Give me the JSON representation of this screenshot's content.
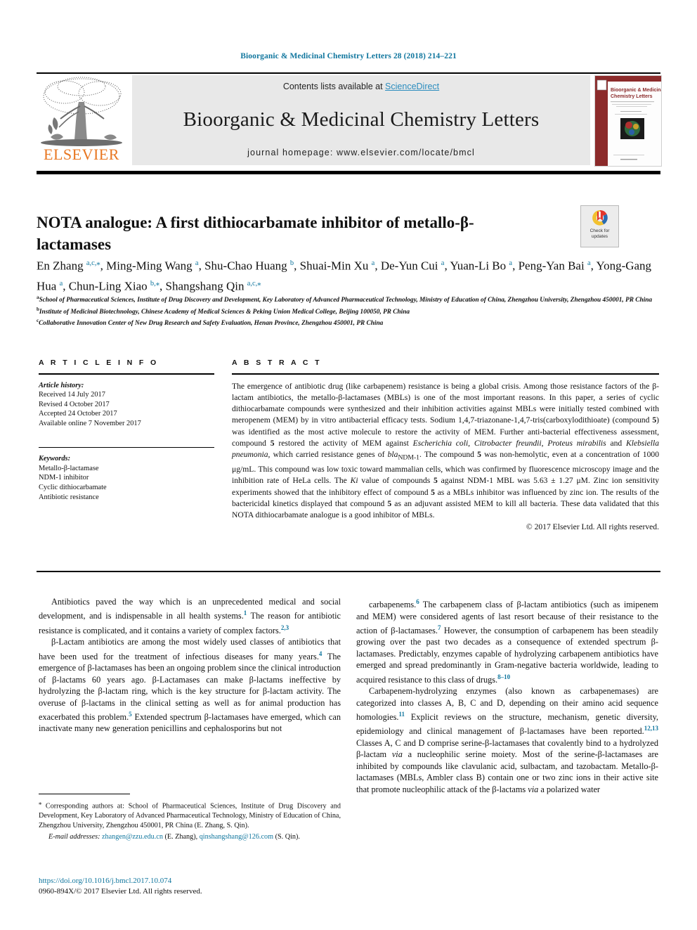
{
  "running_head": "Bioorganic & Medicinal Chemistry Letters 28 (2018) 214–221",
  "masthead": {
    "contents_prefix": "Contents lists available at ",
    "sciencedirect": "ScienceDirect",
    "journal_title": "Bioorganic & Medicinal Chemistry Letters",
    "homepage": "journal homepage: www.elsevier.com/locate/bmcl",
    "publisher_name": "ELSEVIER",
    "cover_title_line1": "Bioorganic & Medicinal",
    "cover_title_line2": "Chemistry Letters"
  },
  "article": {
    "title": "NOTA analogue: A first dithiocarbamate inhibitor of metallo-β-lactamases",
    "crossmark_line1": "Check for",
    "crossmark_line2": "updates",
    "authors_html": "En Zhang <sup>a,c,</sup><sup>⁎</sup>, Ming-Ming Wang <sup>a</sup>, Shu-Chao Huang <sup>b</sup>, Shuai-Min Xu <sup>a</sup>, De-Yun Cui <sup>a</sup>, Yuan-Li Bo <sup>a</sup>, Peng-Yan Bai <sup>a</sup>, Yong-Gang Hua <sup>a</sup>, Chun-Ling Xiao <sup>b,</sup><sup>⁎</sup>, Shangshang Qin <sup>a,c,</sup><sup>⁎</sup>",
    "affiliations": [
      {
        "marker": "a",
        "text": "School of Pharmaceutical Sciences, Institute of Drug Discovery and Development, Key Laboratory of Advanced Pharmaceutical Technology, Ministry of Education of China, Zhengzhou University, Zhengzhou 450001, PR China"
      },
      {
        "marker": "b",
        "text": "Institute of Medicinal Biotechnology, Chinese Academy of Medical Sciences & Peking Union Medical College, Beijing 100050, PR China"
      },
      {
        "marker": "c",
        "text": "Collaborative Innovation Center of New Drug Research and Safety Evaluation, Henan Province, Zhengzhou 450001, PR China"
      }
    ]
  },
  "article_info": {
    "heading": "A R T I C L E   I N F O",
    "history_label": "Article history:",
    "history": [
      "Received 14 July 2017",
      "Revised 4 October 2017",
      "Accepted 24 October 2017",
      "Available online 7 November 2017"
    ],
    "keywords_label": "Keywords:",
    "keywords": [
      "Metallo-β-lactamase",
      "NDM-1 inhibitor",
      "Cyclic dithiocarbamate",
      "Antibiotic resistance"
    ]
  },
  "abstract": {
    "heading": "A B S T R A C T",
    "body_html": "The emergence of antibiotic drug (like carbapenem) resistance is being a global crisis. Among those resistance factors of the β-lactam antibiotics, the metallo-β-lactamases (MBLs) is one of the most important reasons. In this paper, a series of cyclic dithiocarbamate compounds were synthesized and their inhibition activities against MBLs were initially tested combined with meropenem (MEM) by in vitro antibacterial efficacy tests. Sodium 1,4,7-triazonane-1,4,7-tris(carboxylodithioate) (compound <b>5</b>) was identified as the most active molecule to restore the activity of MEM. Further anti-bacterial effectiveness assessment, compound <b>5</b> restored the activity of MEM against <i>Escherichia coli</i>, <i>Citrobacter freundii</i>, <i>Proteus mirabilis</i> and <i>Klebsiella pneumonia</i>, which carried resistance genes of <i>bla</i><sub>NDM-1</sub>. The compound <b>5</b> was non-hemolytic, even at a concentration of 1000 μg/mL. This compound was low toxic toward mammalian cells, which was confirmed by fluorescence microscopy image and the inhibition rate of HeLa cells. The <i>Ki</i> value of compounds <b>5</b> against NDM-1 MBL was 5.63 ± 1.27 μM. Zinc ion sensitivity experiments showed that the inhibitory effect of compound <b>5</b> as a MBLs inhibitor was influenced by zinc ion. The results of the bactericidal kinetics displayed that compound <b>5</b> as an adjuvant assisted MEM to kill all bacteria. These data validated that this NOTA dithiocarbamate analogue is a good inhibitor of MBLs.",
    "copyright": "© 2017 Elsevier Ltd. All rights reserved."
  },
  "body": {
    "left_paragraphs_html": [
      "Antibiotics paved the way which is an unprecedented medical and social development, and is indispensable in all health systems.<sup>1</sup> The reason for antibiotic resistance is complicated, and it contains a variety of complex factors.<sup>2,3</sup>",
      "β-Lactam antibiotics are among the most widely used classes of antibiotics that have been used for the treatment of infectious diseases for many years.<sup>4</sup> The emergence of β-lactamases has been an ongoing problem since the clinical introduction of β-lactams 60 years ago. β-Lactamases can make β-lactams ineffective by hydrolyzing the β-lactam ring, which is the key structure for β-lactam activity. The overuse of β-lactams in the clinical setting as well as for animal production has exacerbated this problem.<sup>5</sup> Extended spectrum β-lactamases have emerged, which can inactivate many new generation penicillins and cephalosporins but not"
    ],
    "right_paragraphs_html": [
      "carbapenems.<sup>6</sup> The carbapenem class of β-lactam antibiotics (such as imipenem and MEM) were considered agents of last resort because of their resistance to the action of β-lactamases.<sup>7</sup> However, the consumption of carbapenem has been steadily growing over the past two decades as a consequence of extended spectrum β-lactamases. Predictably, enzymes capable of hydrolyzing carbapenem antibiotics have emerged and spread predominantly in Gram-negative bacteria worldwide, leading to acquired resistance to this class of drugs.<sup>8–10</sup>",
      "Carbapenem-hydrolyzing enzymes (also known as carbapenemases) are categorized into classes A, B, C and D, depending on their amino acid sequence homologies.<sup>11</sup> Explicit reviews on the structure, mechanism, genetic diversity, epidemiology and clinical management of β-lactamases have been reported.<sup>12,13</sup> Classes A, C and D comprise serine-β-lactamases that covalently bind to a hydrolyzed β-lactam <i>via</i> a nucleophilic serine moiety. Most of the serine-β-lactamases are inhibited by compounds like clavulanic acid, sulbactam, and tazobactam. Metallo-β-lactamases (MBLs, Ambler class B) contain one or two zinc ions in their active site that promote nucleophilic attack of the β-lactams <i>via</i> a polarized water"
    ]
  },
  "footnote": {
    "corresponding_html": "<sup>⁎</sup> Corresponding authors at: School of Pharmaceutical Sciences, Institute of Drug Discovery and Development, Key Laboratory of Advanced Pharmaceutical Technology, Ministry of Education of China, Zhengzhou University, Zhengzhou 450001, PR China (E. Zhang, S. Qin).",
    "email_html": "<span class=\"em\">E-mail addresses:</span> <span class=\"link\">zhangen@zzu.edu.cn</span> (E. Zhang), <span class=\"link\">qinshangshang@126.com</span> (S. Qin)."
  },
  "footer": {
    "doi": "https://doi.org/10.1016/j.bmcl.2017.10.074",
    "issn_line": "0960-894X/© 2017 Elsevier Ltd. All rights reserved."
  },
  "colors": {
    "link_blue": "#10769e",
    "sciencedirect_blue": "#2b8cbe",
    "elsevier_orange": "#e87722",
    "masthead_grey": "#e8e8e8",
    "cover_maroon": "#8c2b2b"
  }
}
